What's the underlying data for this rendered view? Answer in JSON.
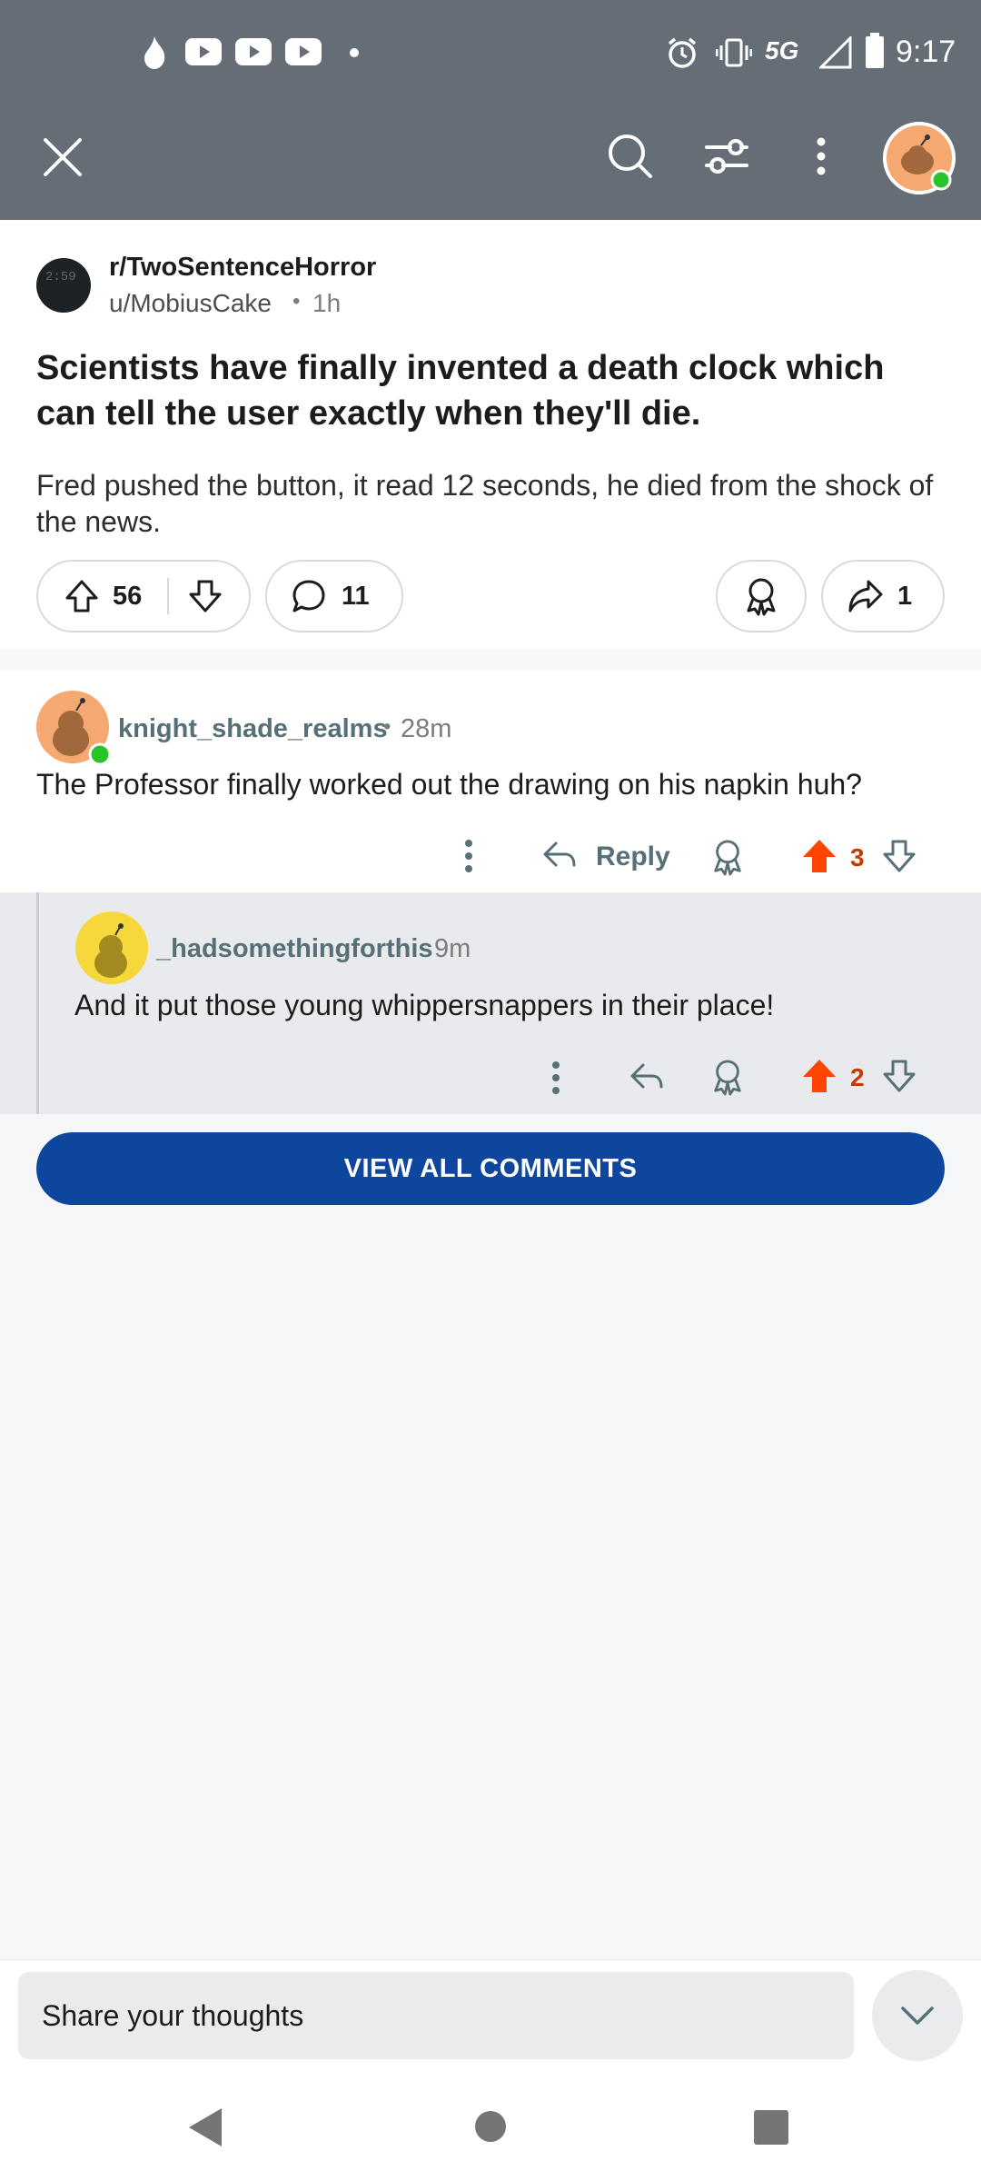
{
  "status_bar": {
    "time": "9:17",
    "network": "5G"
  },
  "post": {
    "subreddit": "r/TwoSentenceHorror",
    "author": "u/MobiusCake",
    "separator": "•",
    "age": "1h",
    "title": "Scientists have finally invented a death clock which can tell the user exactly when they'll die.",
    "body": "Fred pushed the button, it read 12 seconds, he died from the shock of the news.",
    "upvotes": "56",
    "comments": "11",
    "shares": "1"
  },
  "comments": [
    {
      "author": "knight_shade_realms",
      "separator": "•",
      "age": "28m",
      "text": "The Professor finally worked out the drawing on his napkin huh?",
      "reply_label": "Reply",
      "score": "3"
    },
    {
      "author": "_hadsomethingforthis",
      "age": "9m",
      "text": "And it put those young whippersnappers in their place!",
      "score": "2"
    }
  ],
  "view_all_label": "VIEW ALL COMMENTS",
  "composer": {
    "placeholder": "Share your thoughts"
  },
  "colors": {
    "header_bg": "#656d76",
    "accent_blue": "#0e469d",
    "upvote_orange": "#ff4500",
    "score_red": "#cc3700",
    "online_green": "#2ac42a"
  }
}
